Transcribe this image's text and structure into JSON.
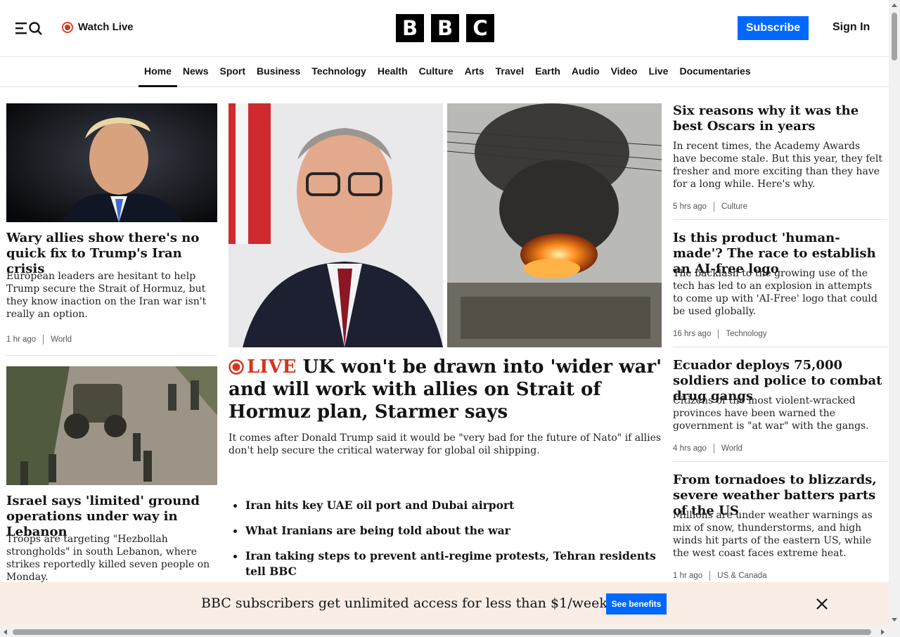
{
  "header": {
    "watch_live": "Watch Live",
    "logo_letters": [
      "B",
      "B",
      "C"
    ],
    "subscribe": "Subscribe",
    "sign_in": "Sign In",
    "accent_color": "#0068ff",
    "live_color": "#d4351c"
  },
  "nav": {
    "items": [
      "Home",
      "News",
      "Sport",
      "Business",
      "Technology",
      "Health",
      "Culture",
      "Arts",
      "Travel",
      "Earth",
      "Audio",
      "Video",
      "Live",
      "Documentaries"
    ],
    "active": "Home"
  },
  "left": {
    "stories": [
      {
        "headline": "Wary allies show there's no quick fix to Trump's Iran crisis",
        "summary": "European leaders are hesitant to help Trump secure the Strait of Hormuz, but they know inaction on the Iran war isn't really an option.",
        "time": "1 hr ago",
        "section": "World"
      },
      {
        "headline": "Israel says 'limited' ground operations under way in Lebanon",
        "summary": "Troops are targeting \"Hezbollah strongholds\" in south Lebanon, where strikes reportedly killed seven people on Monday."
      }
    ]
  },
  "main": {
    "live_label": "LIVE",
    "headline": "UK won't be drawn into 'wider war' and will work with allies on Strait of Hormuz plan, Starmer says",
    "summary": "It comes after Donald Trump said it would be \"very bad for the future of Nato\" if allies don't help secure the critical waterway for global oil shipping.",
    "related": [
      "Iran hits key UAE oil port and Dubai airport",
      "What Iranians are being told about the war",
      "Iran taking steps to prevent anti-regime protests, Tehran residents tell BBC"
    ]
  },
  "right": {
    "stories": [
      {
        "headline": "Six reasons why it was the best Oscars in years",
        "summary": "In recent times, the Academy Awards have become stale. But this year, they felt fresher and more exciting than they have for a long while. Here's why.",
        "time": "5 hrs ago",
        "section": "Culture"
      },
      {
        "headline": "Is this product 'human-made'? The race to establish an AI-free logo",
        "summary": "The backlash to the growing use of the tech has led to an explosion in attempts to come up with 'AI-Free' logo that could be used globally.",
        "time": "16 hrs ago",
        "section": "Technology"
      },
      {
        "headline": "Ecuador deploys 75,000 soldiers and police to combat drug gangs",
        "summary": "Citizens of the most violent-wracked provinces have been warned the government is \"at war\" with the gangs.",
        "time": "4 hrs ago",
        "section": "World"
      },
      {
        "headline": "From tornadoes to blizzards, severe weather batters parts of the US",
        "summary": "Millions are under weather warnings as mix of snow, thunderstorms, and high winds hit parts of the eastern US, while the west coast faces extreme heat.",
        "time": "1 hr ago",
        "section": "US & Canada"
      }
    ]
  },
  "banner": {
    "text": "BBC subscribers get unlimited access for less than $1/week",
    "button": "See benefits",
    "background": "#f9ede6"
  },
  "icons": {
    "menu": "menu-icon",
    "search": "search-icon",
    "live": "live-dot-icon",
    "close": "close-icon"
  }
}
